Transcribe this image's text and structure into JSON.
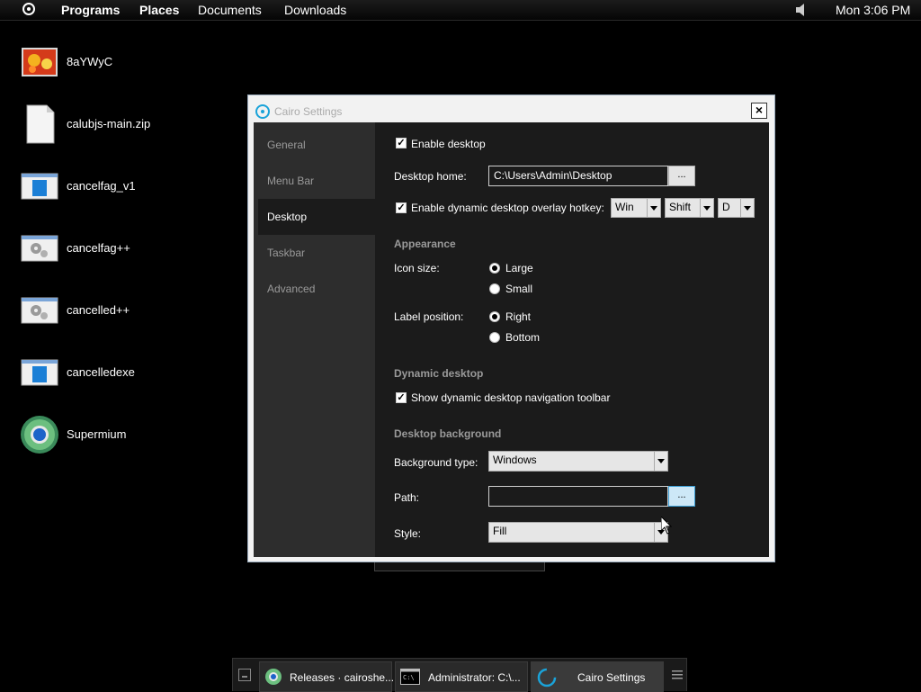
{
  "menubar": {
    "programs": "Programs",
    "places": "Places",
    "documents": "Documents",
    "downloads": "Downloads",
    "clock": "Mon 3:06 PM"
  },
  "desktop": {
    "icons": [
      {
        "label": "8aYWyC",
        "icon": "image-icon"
      },
      {
        "label": "calubjs-main.zip",
        "icon": "file-icon"
      },
      {
        "label": "cancelfag_v1",
        "icon": "window-icon"
      },
      {
        "label": "cancelfag++",
        "icon": "gears-icon"
      },
      {
        "label": "cancelled++",
        "icon": "gears-icon"
      },
      {
        "label": "cancelledexe",
        "icon": "window-icon"
      },
      {
        "label": "Supermium",
        "icon": "browser-icon"
      }
    ]
  },
  "window": {
    "title": "Cairo Settings",
    "close": "×",
    "sidebar": [
      "General",
      "Menu Bar",
      "Desktop",
      "Taskbar",
      "Advanced"
    ],
    "active_tab": "Desktop",
    "desktop": {
      "enable_desktop": "Enable desktop",
      "desktop_home_label": "Desktop home:",
      "desktop_home_value": "C:\\Users\\Admin\\Desktop",
      "browse": "...",
      "overlay_hotkey": "Enable dynamic desktop overlay hotkey:",
      "hotkey_mod1": "Win",
      "hotkey_mod2": "Shift",
      "hotkey_key": "D",
      "appearance": "Appearance",
      "icon_size_label": "Icon size:",
      "icon_large": "Large",
      "icon_small": "Small",
      "label_position_label": "Label position:",
      "label_right": "Right",
      "label_bottom": "Bottom",
      "dynamic_desktop": "Dynamic desktop",
      "show_toolbar": "Show dynamic desktop navigation toolbar",
      "desktop_background": "Desktop background",
      "background_type_label": "Background type:",
      "background_type_value": "Windows",
      "path_label": "Path:",
      "path_value": "",
      "style_label": "Style:",
      "style_value": "Fill"
    }
  },
  "taskbar": {
    "items": [
      {
        "label": "Releases · cairoshe...",
        "icon": "browser-icon"
      },
      {
        "label": "Administrator: C:\\...",
        "icon": "console-icon"
      },
      {
        "label": "Cairo Settings",
        "icon": "cairo-icon"
      }
    ]
  },
  "colors": {
    "accent": "#1aa3d9",
    "window_bg": "#1b1b1b",
    "sidebar_bg": "#2d2d2d"
  }
}
